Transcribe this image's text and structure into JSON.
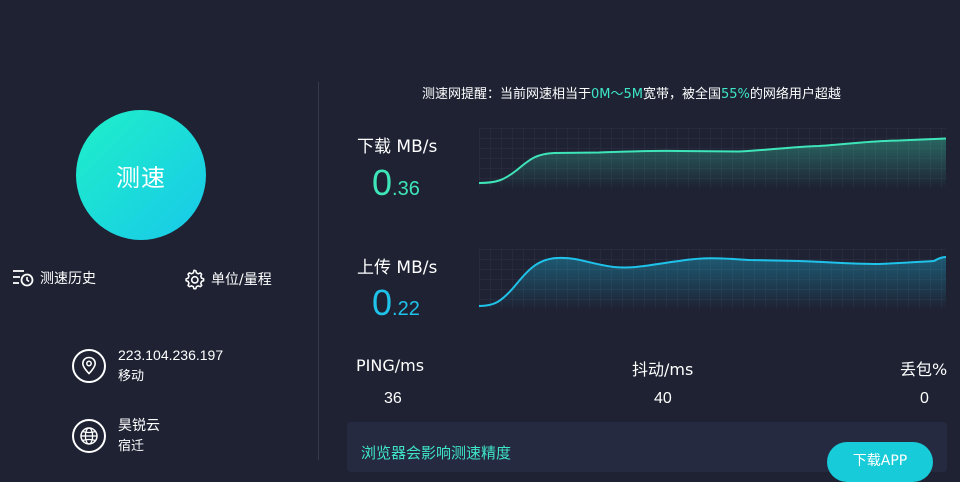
{
  "left": {
    "test_button_label": "测速",
    "history_label": "测速历史",
    "unit_label": "单位/量程",
    "ip": "223.104.236.197",
    "carrier": "移动",
    "isp": "昊锐云",
    "location": "宿迁"
  },
  "notice": {
    "prefix": "测速网提醒：当前网速相当于",
    "range": "0M～5M",
    "middle": "宽带，被全国",
    "percent": "55%",
    "suffix": "的网络用户超越"
  },
  "download": {
    "label": "下载 MB/s",
    "value_int": "0",
    "value_dec": ".36"
  },
  "upload": {
    "label": "上传 MB/s",
    "value_int": "0",
    "value_dec": ".22"
  },
  "stats": {
    "ping_label": "PING/ms",
    "ping_value": "36",
    "jitter_label": "抖动/ms",
    "jitter_value": "40",
    "loss_label": "丢包%",
    "loss_value": "0"
  },
  "bottom": {
    "browser_note": "浏览器会影响测速精度",
    "app_button": "下载APP"
  },
  "colors": {
    "background": "#1e2233",
    "accent_green": "#3ee5c7",
    "accent_blue": "#1fc3ea"
  }
}
